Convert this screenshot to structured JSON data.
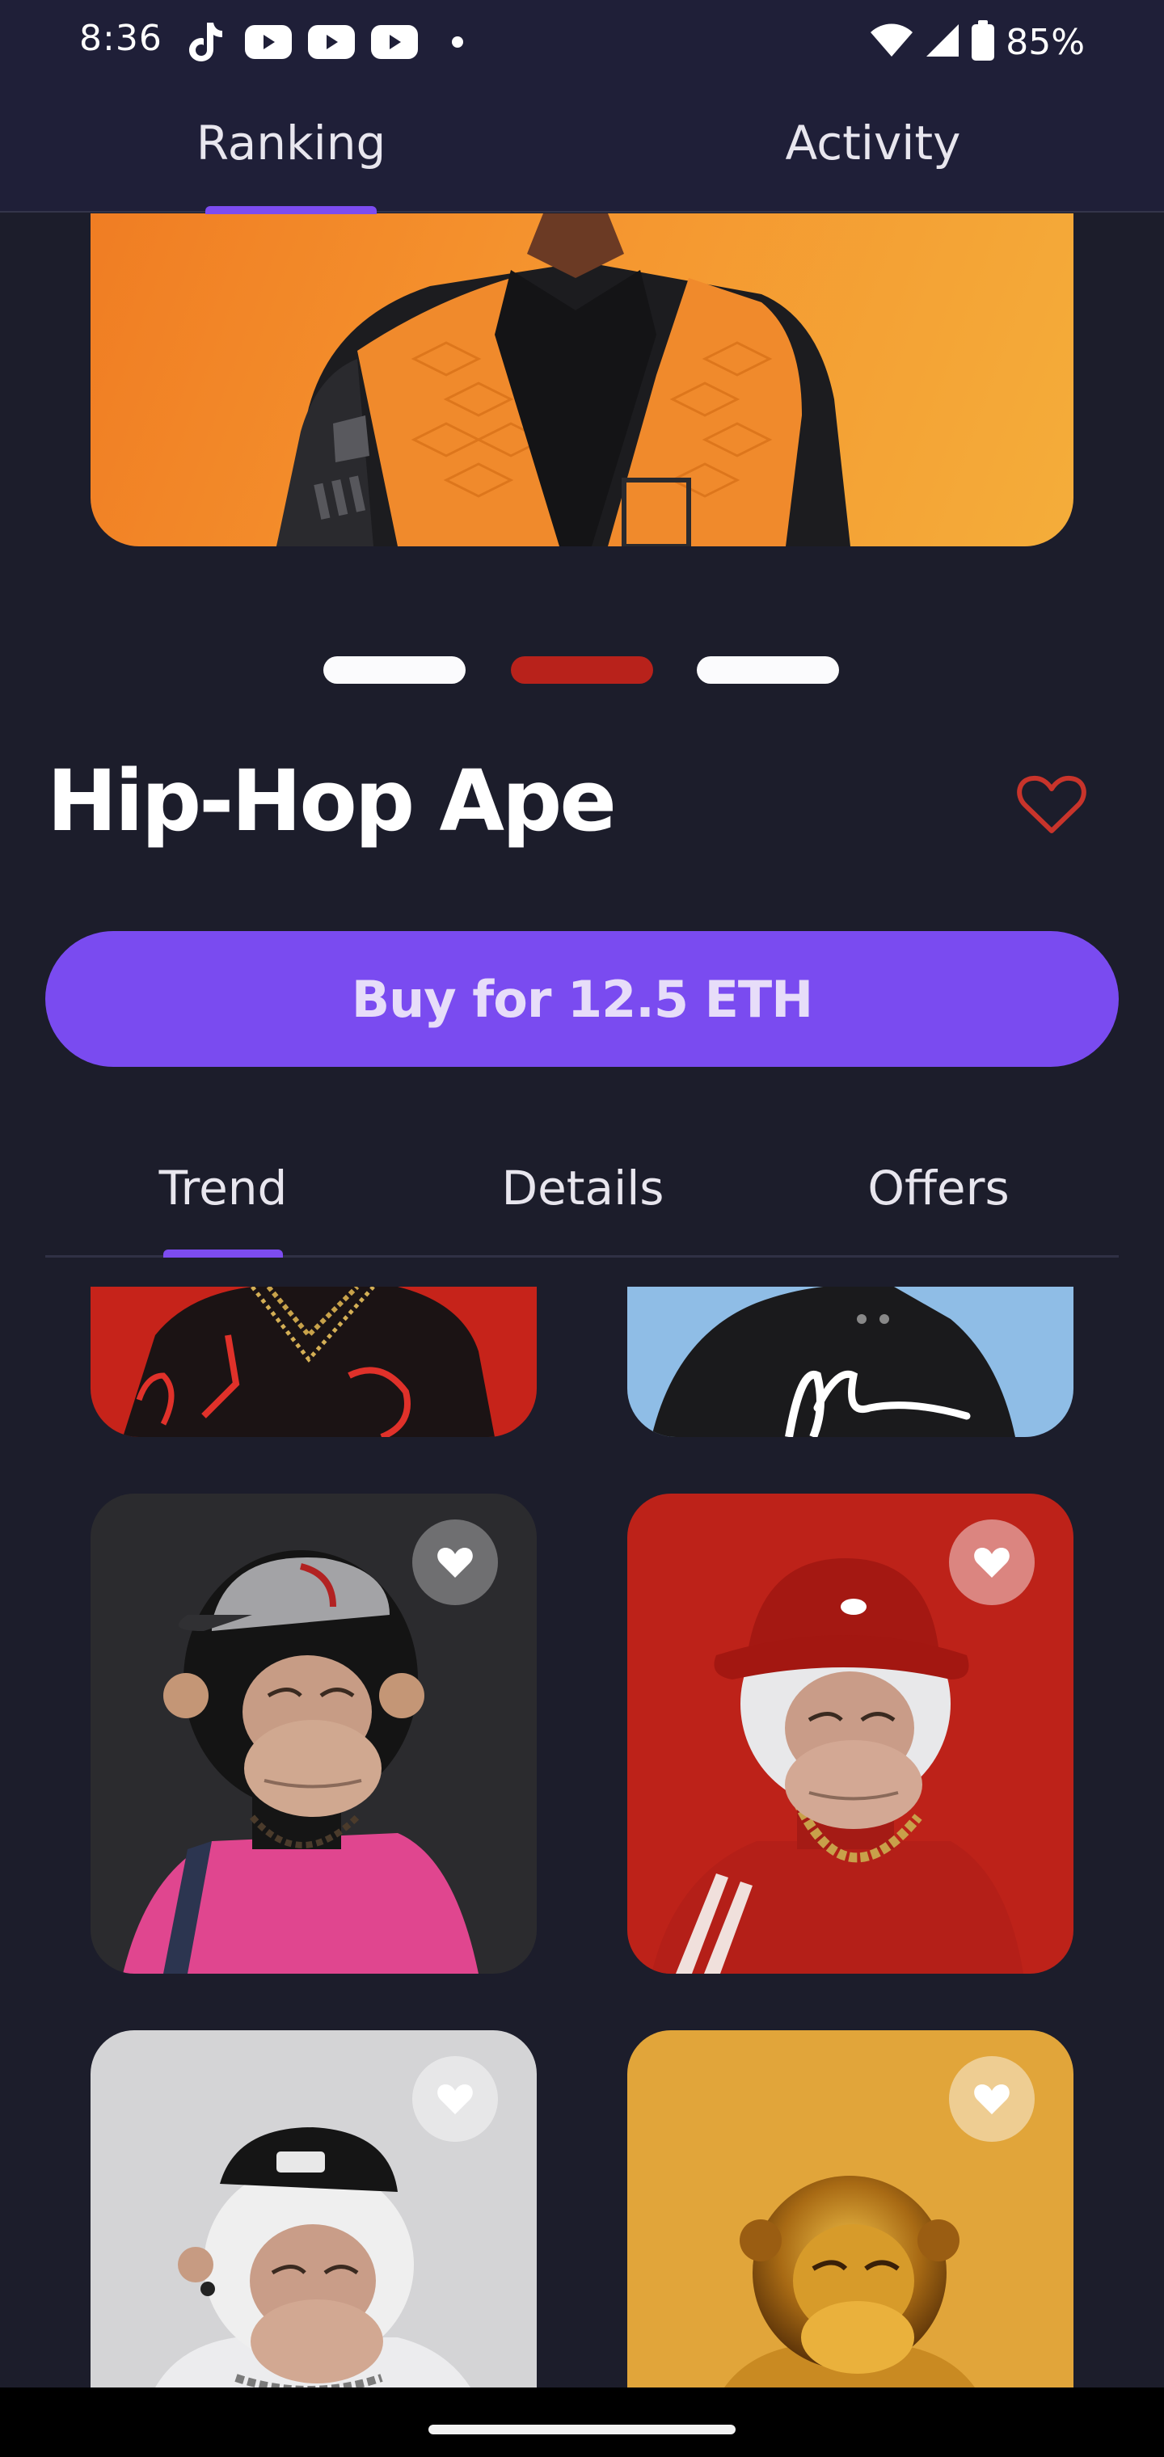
{
  "status_bar": {
    "time": "8:36",
    "battery": "85%",
    "app_icons": [
      "tiktok-icon",
      "youtube-icon",
      "youtube-icon",
      "youtube-icon",
      "dot-icon"
    ],
    "system_icons": [
      "wifi-icon",
      "signal-icon",
      "battery-icon"
    ]
  },
  "top_tabs": {
    "items": [
      {
        "label": "Ranking",
        "active": true
      },
      {
        "label": "Activity",
        "active": false
      }
    ],
    "accent": "#7d4cf0"
  },
  "carousel": {
    "page_count": 3,
    "active_index": 1,
    "active_color": "#b8221b"
  },
  "nft": {
    "title": "Hip-Hop Ape",
    "favorite_icon": "heart-outline-icon",
    "buy_label": "Buy for 12.5 ETH"
  },
  "detail_tabs": {
    "items": [
      {
        "label": "Trend",
        "active": true
      },
      {
        "label": "Details",
        "active": false
      },
      {
        "label": "Offers",
        "active": false
      }
    ]
  },
  "grid": {
    "cards": [
      {
        "name": "ape-card-red-jersey",
        "background": "#c6231a"
      },
      {
        "name": "ape-card-black-hoodie",
        "background": "#8fbde6"
      },
      {
        "name": "ape-card-pink-shirt",
        "background": "#2b2b2e",
        "favorite_icon": "heart-icon"
      },
      {
        "name": "ape-card-red-bucket-hat",
        "background": "#bd2219",
        "favorite_icon": "heart-icon"
      },
      {
        "name": "ape-card-white-beanie",
        "background": "#d4d4d6",
        "favorite_icon": "heart-icon"
      },
      {
        "name": "ape-card-golden",
        "background": "#e1a53a",
        "favorite_icon": "heart-icon"
      }
    ]
  },
  "colors": {
    "background": "#1c1d2b",
    "app_bar": "#1f1f38",
    "button": "#7a4bf0",
    "heart": "#c8342b"
  }
}
